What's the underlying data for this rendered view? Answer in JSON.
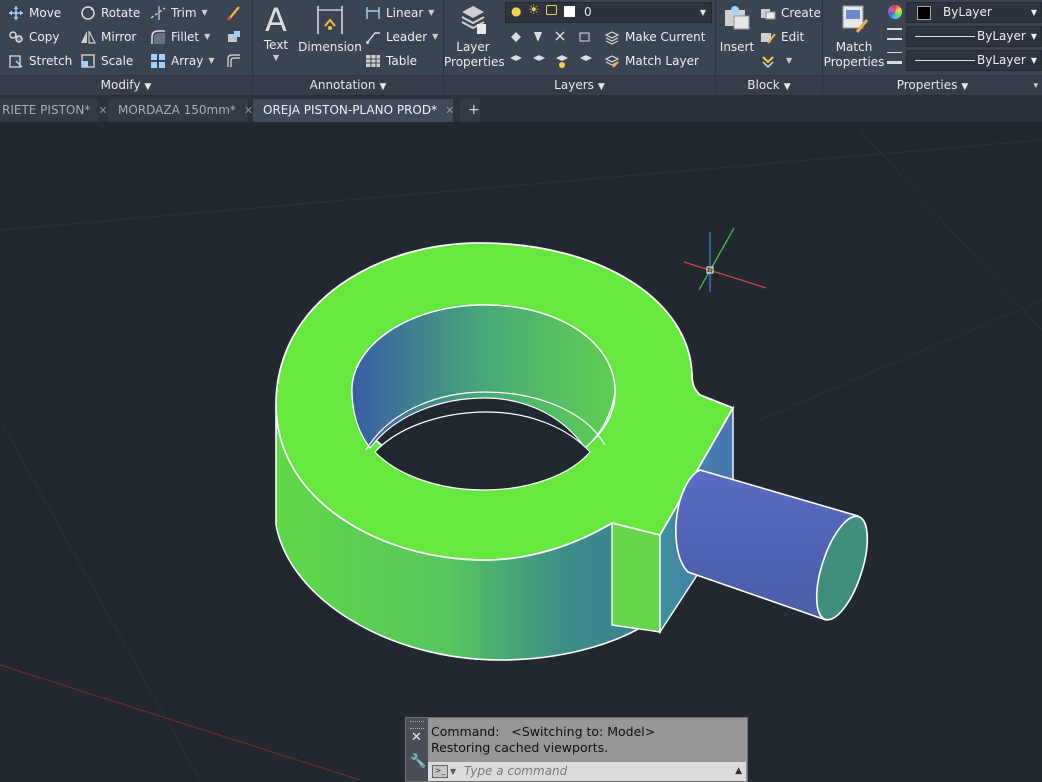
{
  "ribbon": {
    "modify": {
      "title": "Modify",
      "move": "Move",
      "rotate": "Rotate",
      "trim": "Trim",
      "copy": "Copy",
      "mirror": "Mirror",
      "fillet": "Fillet",
      "stretch": "Stretch",
      "scale": "Scale",
      "array": "Array"
    },
    "annotation": {
      "title": "Annotation",
      "text": "Text",
      "dimension": "Dimension",
      "linear": "Linear",
      "leader": "Leader",
      "table": "Table"
    },
    "layers": {
      "title": "Layers",
      "layer_properties_line1": "Layer",
      "layer_properties_line2": "Properties",
      "current_layer": "0",
      "make_current": "Make Current",
      "match_layer": "Match Layer"
    },
    "block": {
      "title": "Block",
      "insert": "Insert",
      "create": "Create",
      "edit": "Edit"
    },
    "properties": {
      "title": "Properties",
      "match_line1": "Match",
      "match_line2": "Properties",
      "color": "ByLayer",
      "linetype": "ByLayer",
      "lineweight": "ByLayer"
    }
  },
  "tabs": [
    {
      "label": "RIETE PISTON*",
      "active": false
    },
    {
      "label": "MORDAZA 150mm*",
      "active": false
    },
    {
      "label": "OREJA PISTON-PLANO PROD*",
      "active": true
    }
  ],
  "command": {
    "line1": "Command:   <Switching to: Model>",
    "line2": "Restoring cached viewports.",
    "placeholder": "Type a command"
  },
  "colors": {
    "ribbon_bg": "#3b4453",
    "viewport_bg": "#212830",
    "model_green": "#66e83e",
    "model_blue": "#5563b8"
  }
}
